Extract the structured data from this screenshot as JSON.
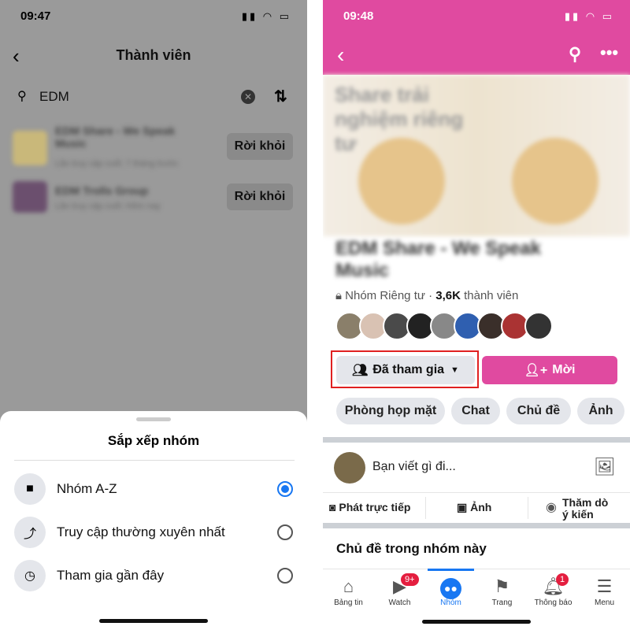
{
  "left": {
    "status_time": "09:47",
    "title": "Thành viên",
    "search_value": "EDM",
    "groups": [
      {
        "name": "EDM Share - We Speak Music",
        "meta": "Lần truy cập cuối: 7 tháng trước",
        "action": "Rời khỏi"
      },
      {
        "name": "EDM Trolls Group",
        "meta": "Lần truy cập cuối: Hôm nay",
        "action": "Rời khỏi"
      }
    ],
    "sheet": {
      "title": "Sắp xếp nhóm",
      "options": [
        {
          "label": "Nhóm A-Z",
          "icon": "book-icon",
          "selected": true
        },
        {
          "label": "Truy cập thường xuyên nhất",
          "icon": "trend-icon",
          "selected": false
        },
        {
          "label": "Tham gia gần đây",
          "icon": "clock-icon",
          "selected": false
        }
      ]
    }
  },
  "right": {
    "status_time": "09:48",
    "accent": "#e04aa0",
    "cover_text": "Share trải nghiệm riêng tư",
    "group_name": "EDM Share - We Speak Music",
    "privacy": "Nhóm Riêng tư",
    "member_count": "3,6K",
    "member_label": "thành viên",
    "joined_label": "Đã tham gia",
    "invite_label": "Mời",
    "chips": [
      "Phòng họp mặt",
      "Chat",
      "Chủ đề",
      "Ảnh"
    ],
    "composer_placeholder": "Bạn viết gì đi...",
    "actions": [
      "Phát trực tiếp",
      "Ảnh",
      "Thăm dò ý kiến"
    ],
    "topics_heading": "Chủ đề trong nhóm này",
    "tabs": [
      {
        "label": "Bảng tin",
        "icon": "home-icon"
      },
      {
        "label": "Watch",
        "icon": "video-icon",
        "badge": "9+"
      },
      {
        "label": "Nhóm",
        "icon": "groups-icon",
        "active": true
      },
      {
        "label": "Trang",
        "icon": "flag-icon"
      },
      {
        "label": "Thông báo",
        "icon": "bell-icon",
        "badge": "1"
      },
      {
        "label": "Menu",
        "icon": "menu-icon"
      }
    ]
  }
}
